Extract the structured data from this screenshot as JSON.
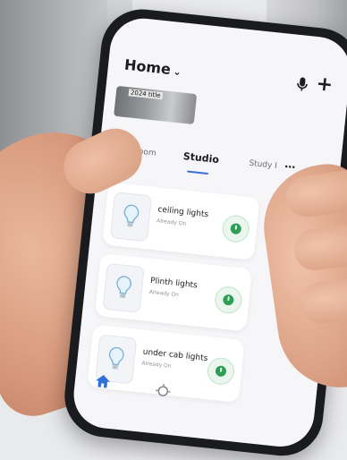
{
  "app": {
    "title": "Home",
    "cover_label": "2024 title"
  },
  "tabs": [
    {
      "label": "Dining Room",
      "active": false
    },
    {
      "label": "Studio",
      "active": true
    },
    {
      "label": "Study I",
      "active": false
    }
  ],
  "devices": [
    {
      "name": "ceiling lights",
      "status": "Already On"
    },
    {
      "name": "Plinth lights",
      "status": "Already On"
    },
    {
      "name": "under cab lights",
      "status": "Already On"
    }
  ],
  "nav": [
    {
      "icon": "home-icon",
      "active": true
    },
    {
      "icon": "bulb-icon",
      "active": false
    }
  ],
  "colors": {
    "accent": "#3a6fd8",
    "power_on": "#2e9e55",
    "power_bg": "#eaf6ee"
  }
}
